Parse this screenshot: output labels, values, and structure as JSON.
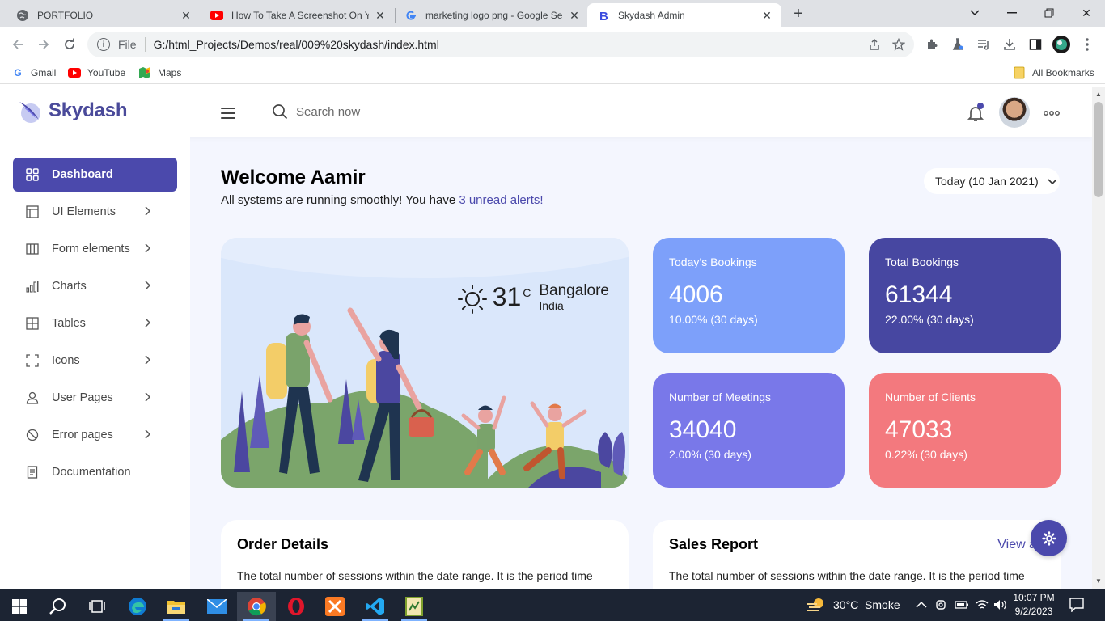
{
  "browser": {
    "tabs": [
      {
        "title": "PORTFOLIO",
        "favicon": "globe-icon"
      },
      {
        "title": "How To Take A Screenshot On Yo",
        "favicon": "youtube-icon"
      },
      {
        "title": "marketing logo png - Google Se",
        "favicon": "google-icon"
      },
      {
        "title": "Skydash Admin",
        "favicon": "bootstrap-icon",
        "active": true
      }
    ],
    "scheme": "File",
    "url": "G:/html_Projects/Demos/real/009%20skydash/index.html",
    "bookmarks": [
      {
        "label": "Gmail"
      },
      {
        "label": "YouTube"
      },
      {
        "label": "Maps"
      }
    ],
    "all_bookmarks": "All Bookmarks"
  },
  "app": {
    "brand": "Skydash",
    "search_placeholder": "Search now",
    "accent_color": "#4b49ac",
    "sidebar": [
      {
        "label": "Dashboard",
        "icon": "grid-icon",
        "active": true
      },
      {
        "label": "UI Elements",
        "icon": "layout-icon"
      },
      {
        "label": "Form elements",
        "icon": "columns-icon"
      },
      {
        "label": "Charts",
        "icon": "bar-chart-icon"
      },
      {
        "label": "Tables",
        "icon": "table-icon"
      },
      {
        "label": "Icons",
        "icon": "expand-icon"
      },
      {
        "label": "User Pages",
        "icon": "user-icon"
      },
      {
        "label": "Error pages",
        "icon": "ban-icon"
      },
      {
        "label": "Documentation",
        "icon": "document-icon"
      }
    ],
    "welcome": {
      "title": "Welcome Aamir",
      "subtitle_prefix": "All systems are running smoothly! You have ",
      "alerts_link": "3 unread alerts!"
    },
    "date_filter": "Today (10 Jan 2021)",
    "weather": {
      "temp": "31",
      "unit": "C",
      "city": "Bangalore",
      "country": "India"
    },
    "stats": [
      {
        "label": "Today’s Bookings",
        "value": "4006",
        "change": "10.00% (30 days)",
        "color": "#7da0fa"
      },
      {
        "label": "Total Bookings",
        "value": "61344",
        "change": "22.00% (30 days)",
        "color": "#4747a1"
      },
      {
        "label": "Number of Meetings",
        "value": "34040",
        "change": "2.00% (30 days)",
        "color": "#7978e9"
      },
      {
        "label": "Number of Clients",
        "value": "47033",
        "change": "0.22% (30 days)",
        "color": "#f3797e"
      }
    ],
    "cards": [
      {
        "title": "Order Details",
        "text": "The total number of sessions within the date range. It is the period time"
      },
      {
        "title": "Sales Report",
        "text": "The total number of sessions within the date range. It is the period time",
        "link": "View a"
      }
    ]
  },
  "taskbar": {
    "weather": "30°C  Smoke",
    "time": "10:07 PM",
    "date": "9/2/2023"
  }
}
